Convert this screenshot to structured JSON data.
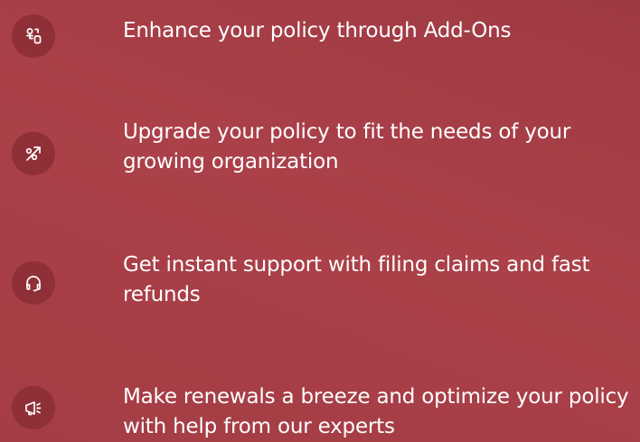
{
  "features": [
    {
      "icon": "add-ons-icon",
      "text": "Enhance your policy through Add-Ons"
    },
    {
      "icon": "trend-up-percent-icon",
      "text": "Upgrade your policy to fit the needs of your growing organization"
    },
    {
      "icon": "headset-icon",
      "text": "Get instant support with filing claims and fast refunds"
    },
    {
      "icon": "megaphone-icon",
      "text": "Make renewals a breeze and optimize your policy with help from our experts"
    }
  ],
  "colors": {
    "background": "#a43d45",
    "icon_circle": "#8f2f37",
    "text": "#ffffff"
  }
}
